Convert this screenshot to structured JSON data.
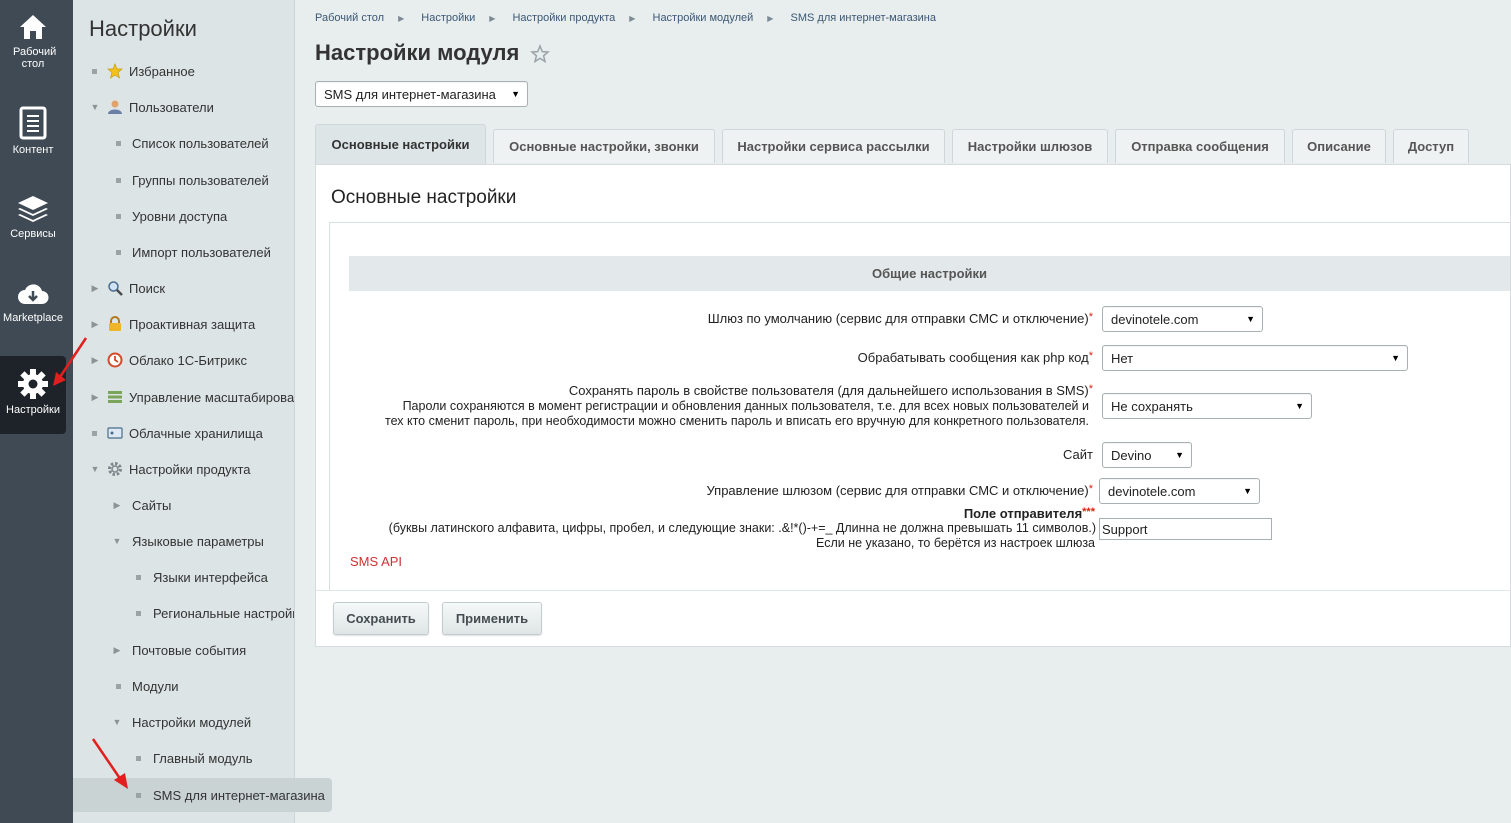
{
  "iconbar": {
    "items": [
      {
        "label": "Рабочий стол",
        "icon": "home-icon"
      },
      {
        "label": "Контент",
        "icon": "document-icon"
      },
      {
        "label": "Сервисы",
        "icon": "layers-icon"
      },
      {
        "label": "Marketplace",
        "icon": "cloud-download-icon"
      },
      {
        "label": "Настройки",
        "icon": "gear-icon"
      }
    ]
  },
  "menu": {
    "title": "Настройки",
    "items": [
      {
        "label": "Избранное",
        "icon": "star-icon"
      },
      {
        "label": "Пользователи",
        "icon": "user-icon"
      },
      {
        "label": "Список пользователей"
      },
      {
        "label": "Группы пользователей"
      },
      {
        "label": "Уровни доступа"
      },
      {
        "label": "Импорт пользователей"
      },
      {
        "label": "Поиск",
        "icon": "search-icon"
      },
      {
        "label": "Проактивная защита",
        "icon": "lock-icon"
      },
      {
        "label": "Облако 1С-Битрикс",
        "icon": "cloud-icon"
      },
      {
        "label": "Управление масштабирова",
        "icon": "server-icon"
      },
      {
        "label": "Облачные хранилища",
        "icon": "storage-icon"
      },
      {
        "label": "Настройки продукта",
        "icon": "gear-icon"
      },
      {
        "label": "Сайты"
      },
      {
        "label": "Языковые параметры"
      },
      {
        "label": "Языки интерфейса"
      },
      {
        "label": "Региональные настройк"
      },
      {
        "label": "Почтовые события"
      },
      {
        "label": "Модули"
      },
      {
        "label": "Настройки модулей"
      },
      {
        "label": "Главный модуль"
      },
      {
        "label": "SMS для интернет-магазина"
      }
    ]
  },
  "breadcrumbs": [
    "Рабочий стол",
    "Настройки",
    "Настройки продукта",
    "Настройки модулей",
    "SMS для интернет-магазина"
  ],
  "page_title": "Настройки модуля",
  "module_select": "SMS для интернет-магазина",
  "tabs": [
    "Основные настройки",
    "Основные настройки, звонки",
    "Настройки сервиса рассылки",
    "Настройки шлюзов",
    "Отправка сообщения",
    "Описание",
    "Доступ"
  ],
  "panel": {
    "title": "Основные настройки",
    "section": "Общие настройки",
    "fields": {
      "gateway_label": "Шлюз по умолчанию (сервис для отправки СМС и отключение)",
      "gateway_value": "devinotele.com",
      "php_label": "Обрабатывать сообщения как php код",
      "php_value": "Нет",
      "password_label_1": "Сохранять пароль в свойстве пользователя (для дальнейшего использования в SMS)",
      "password_label_2": "Пароли сохраняются в момент регистрации и обновления данных пользователя, т.е. для всех новых пользователей и",
      "password_label_3": "тех кто сменит пароль, при необходимости можно сменить пароль и вписать его вручную для конкретного пользователя.",
      "password_value": "Не сохранять",
      "site_label": "Сайт",
      "site_value": "Devino",
      "gateway_control_label": "Управление шлюзом (сервис для отправки СМС и отключение)",
      "gateway_control_value": "devinotele.com",
      "sender_label": "Поле отправителя",
      "sender_req": "***",
      "sender_hint_1": "(буквы латинского алфавита, цифры, пробел, и следующие знаки: .&!*()-+=_ Длинна не должна превышать 11 символов.)",
      "sender_hint_2": "Если не указано, то берётся из настроек шлюза",
      "sender_value": "Support",
      "required_mark": "*"
    },
    "api_link": "SMS API",
    "save_label": "Сохранить",
    "apply_label": "Применить"
  }
}
